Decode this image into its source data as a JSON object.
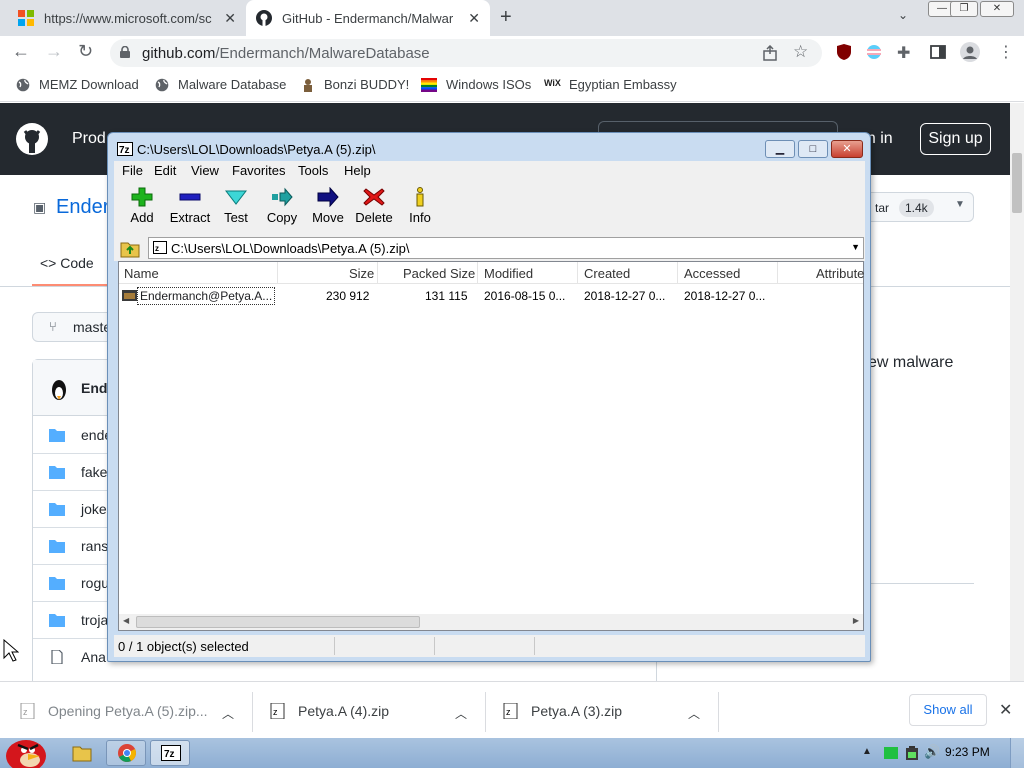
{
  "browser": {
    "tabs": [
      {
        "title": "https://www.microsoft.com/sc",
        "active": false
      },
      {
        "title": "GitHub - Endermanch/Malwar",
        "active": true
      }
    ],
    "url_host": "github.com",
    "url_path": "/Endermanch/MalwareDatabase",
    "extension_badge": "15",
    "bookmarks": [
      "MEMZ Download",
      "Malware Database",
      "Bonzi BUDDY!",
      "Windows ISOs",
      "Egyptian Embassy"
    ]
  },
  "github": {
    "nav_product": "Prod",
    "sign_in": "gn in",
    "sign_up": "Sign up",
    "repo_name": "Ender",
    "star_label": "tar",
    "star_count": "1.4k",
    "code_tab": "Code",
    "branch": "maste",
    "commit_author": "End",
    "files": [
      "ende",
      "fake",
      "joke",
      "rans",
      "rogu",
      "troja",
      "Ana"
    ],
    "about_desc": "ew malware"
  },
  "sevenzip": {
    "title": "C:\\Users\\LOL\\Downloads\\Petya.A (5).zip\\",
    "menu": [
      "File",
      "Edit",
      "View",
      "Favorites",
      "Tools",
      "Help"
    ],
    "toolbar": [
      "Add",
      "Extract",
      "Test",
      "Copy",
      "Move",
      "Delete",
      "Info"
    ],
    "address": "C:\\Users\\LOL\\Downloads\\Petya.A (5).zip\\",
    "columns": [
      "Name",
      "Size",
      "Packed Size",
      "Modified",
      "Created",
      "Accessed",
      "Attribute"
    ],
    "rows": [
      {
        "name": "Endermanch@Petya.A...",
        "size": "230 912",
        "packed": "131 115",
        "modified": "2016-08-15 0...",
        "created": "2018-12-27 0...",
        "accessed": "2018-12-27 0..."
      }
    ],
    "status": "0 / 1 object(s) selected"
  },
  "downloads": {
    "items": [
      "Opening Petya.A (5).zip...",
      "Petya.A (4).zip",
      "Petya.A (3).zip"
    ],
    "show_all": "Show all"
  },
  "taskbar": {
    "time": "9:23 PM"
  }
}
